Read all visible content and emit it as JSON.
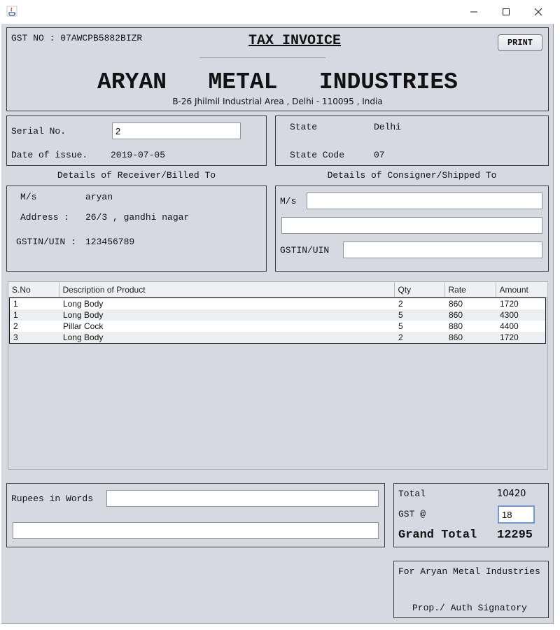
{
  "window": {
    "controls": [
      "minimize",
      "maximize",
      "close"
    ]
  },
  "header": {
    "gst_label": "GST NO : 07AWCPB5882BIZR",
    "doc_title": "TAX INVOICE",
    "print_button": "PRINT",
    "company_name": "ARYAN   METAL   INDUSTRIES",
    "company_address": "B-26  Jhilmil Industrial Area , Delhi - 110095 , India"
  },
  "invoice": {
    "serial_label": "Serial No.",
    "serial_value": "2",
    "date_label": "Date of issue.",
    "date_value": "2019-07-05"
  },
  "state": {
    "state_label": "State",
    "state_value": "Delhi",
    "code_label": "State Code",
    "code_value": "07"
  },
  "receiver": {
    "heading": "Details of Receiver/Billed To",
    "ms_label": "M/s",
    "ms_value": "aryan",
    "address_label": "Address :",
    "address_value": "26/3 , gandhi nagar",
    "gstin_label": "GSTIN/UIN :",
    "gstin_value": "123456789"
  },
  "consignee": {
    "heading": "Details of Consigner/Shipped To",
    "ms_label": "M/s",
    "ms_value": "",
    "address_value": "",
    "gstin_label": "GSTIN/UIN",
    "gstin_value": ""
  },
  "items_table": {
    "columns": [
      "S.No",
      "Description of Product",
      "Qty",
      "Rate",
      "Amount"
    ],
    "rows": [
      [
        "1",
        "Long Body",
        "2",
        "860",
        "1720"
      ],
      [
        "1",
        "Long Body",
        "5",
        "860",
        "4300"
      ],
      [
        "2",
        "Pillar Cock",
        "5",
        "880",
        "4400"
      ],
      [
        "3",
        "Long Body",
        "2",
        "860",
        "1720"
      ]
    ]
  },
  "words": {
    "label": "Rupees in Words",
    "line1": "",
    "line2": ""
  },
  "totals": {
    "total_label": "Total",
    "total_value": "10420",
    "gst_label": "GST @",
    "gst_value": "18",
    "grand_label": "Grand Total",
    "grand_value": "12295"
  },
  "signatory": {
    "for_line": "For Aryan Metal Industries",
    "sign_line": "Prop./ Auth Signatory"
  }
}
